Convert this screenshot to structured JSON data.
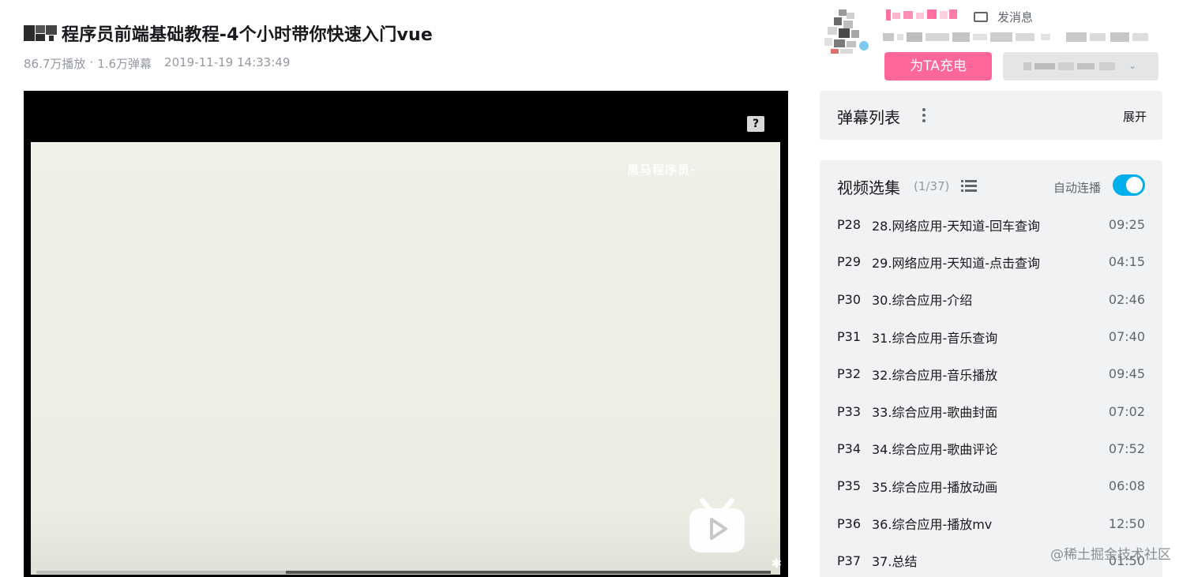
{
  "video": {
    "title": "程序员前端基础教程-4个小时带你快速入门vue",
    "views": "86.7万播放",
    "danmaku_count": "1.6万弹幕",
    "separator": "·",
    "date": "2019-11-19 14:33:49"
  },
  "player": {
    "watermark": "黑马程序员-",
    "help_glyph": "?",
    "progress": 0.34
  },
  "uploader": {
    "message_label": "发消息",
    "charge_label": "为TA充电",
    "follow_chevron": "⌄"
  },
  "danmaku": {
    "title": "弹幕列表",
    "expand_label": "展开"
  },
  "episodes": {
    "title": "视频选集",
    "count": "(1/37)",
    "autoplay_label": "自动连播",
    "autoplay_on": true,
    "items": [
      {
        "p": "P28",
        "name": "28.网络应用-天知道-回车查询",
        "dur": "09:25"
      },
      {
        "p": "P29",
        "name": "29.网络应用-天知道-点击查询",
        "dur": "04:15"
      },
      {
        "p": "P30",
        "name": "30.综合应用-介绍",
        "dur": "02:46"
      },
      {
        "p": "P31",
        "name": "31.综合应用-音乐查询",
        "dur": "07:40"
      },
      {
        "p": "P32",
        "name": "32.综合应用-音乐播放",
        "dur": "09:45"
      },
      {
        "p": "P33",
        "name": "33.综合应用-歌曲封面",
        "dur": "07:02"
      },
      {
        "p": "P34",
        "name": "34.综合应用-歌曲评论",
        "dur": "07:52"
      },
      {
        "p": "P35",
        "name": "35.综合应用-播放动画",
        "dur": "06:08"
      },
      {
        "p": "P36",
        "name": "36.综合应用-播放mv",
        "dur": "12:50"
      },
      {
        "p": "P37",
        "name": "37.总结",
        "dur": "01:50"
      }
    ]
  },
  "site_watermark": "@稀土掘金技术社区",
  "colors": {
    "pink": "#ff6699",
    "blue": "#00aeec",
    "panel_bg": "#f1f2f3",
    "text_gray": "#9499a0"
  }
}
